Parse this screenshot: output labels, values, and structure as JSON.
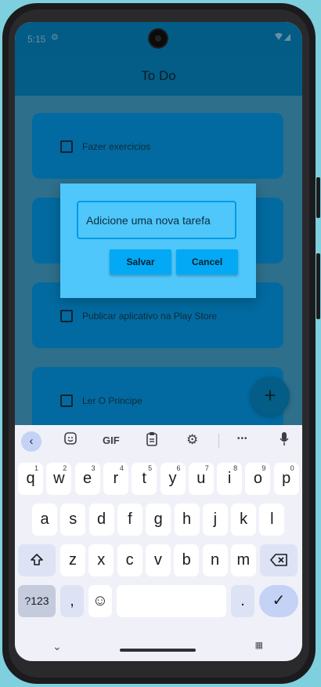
{
  "status_bar": {
    "time": "5:15",
    "status_icon": "gear-icon",
    "signal_icons": "wifi-signal-icons"
  },
  "app_bar": {
    "title": "To Do"
  },
  "tasks": [
    {
      "label": "Fazer exercicios"
    },
    {
      "label": ""
    },
    {
      "label": "Publicar aplicativo na Play Store"
    },
    {
      "label": "Ler O Principe"
    }
  ],
  "fab": {
    "label": "+"
  },
  "dialog": {
    "input_placeholder": "Adicione uma nova tarefa",
    "save_label": "Salvar",
    "cancel_label": "Cancel"
  },
  "keyboard": {
    "toolbar": {
      "back": "‹",
      "gif": "GIF",
      "more": "•••"
    },
    "row1": [
      {
        "key": "q",
        "hint": "1"
      },
      {
        "key": "w",
        "hint": "2"
      },
      {
        "key": "e",
        "hint": "3"
      },
      {
        "key": "r",
        "hint": "4"
      },
      {
        "key": "t",
        "hint": "5"
      },
      {
        "key": "y",
        "hint": "6"
      },
      {
        "key": "u",
        "hint": "7"
      },
      {
        "key": "i",
        "hint": "8"
      },
      {
        "key": "o",
        "hint": "9"
      },
      {
        "key": "p",
        "hint": "0"
      }
    ],
    "row2": [
      "a",
      "s",
      "d",
      "f",
      "g",
      "h",
      "j",
      "k",
      "l"
    ],
    "row3": [
      "z",
      "x",
      "c",
      "v",
      "b",
      "n",
      "m"
    ],
    "symbols_label": "?123",
    "comma": ",",
    "period": ".",
    "emoji": "☺",
    "enter_icon": "✓"
  },
  "colors": {
    "app_bar": "#035d86",
    "dialog": "#4fc7fb",
    "button": "#03a9f4",
    "card": "#026aa0"
  }
}
